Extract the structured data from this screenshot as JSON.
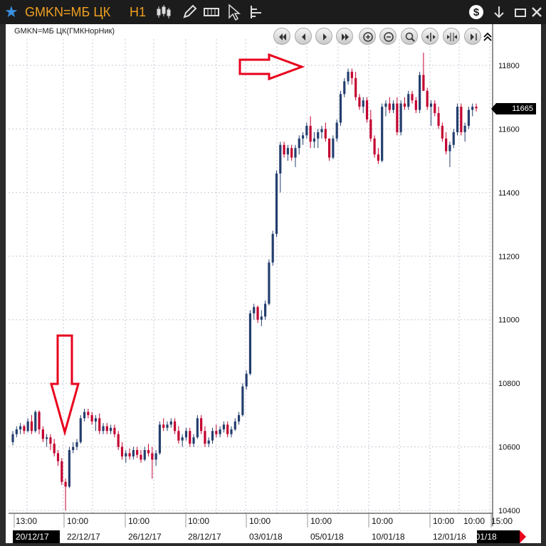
{
  "window": {
    "ticker": "GMKN=МБ ЦК",
    "timeframe": "H1",
    "instrument_label": "GMKN=МБ ЦК(ГМКНорНик)"
  },
  "toolbar": {
    "icons": [
      "star-icon",
      "candles-icon",
      "pencil-icon",
      "chart-type-icon",
      "cursor-icon",
      "levels-icon",
      "dollar-icon",
      "download-icon",
      "minimize-icon",
      "close-icon"
    ]
  },
  "nav": {
    "icons": [
      "scroll-begin-icon",
      "scroll-left-icon",
      "scroll-right-icon",
      "scroll-end-icon",
      "zoom-in-icon",
      "zoom-out-icon",
      "magnifier-icon",
      "compress-icon",
      "expand-icon",
      "scroll-last-icon"
    ]
  },
  "price_tag": "11665",
  "chart_data": {
    "type": "candlestick",
    "ylim": [
      10400,
      11850
    ],
    "yticks": [
      10400,
      10600,
      10800,
      11000,
      11200,
      11400,
      11600,
      11800
    ],
    "time_ticks": [
      "13:00",
      "10:00",
      "10:00",
      "10:00",
      "10:00",
      "10:00",
      "10:00",
      "10:00",
      "10:00",
      "15:00"
    ],
    "date_ticks": [
      "20/12/17",
      "22/12/17",
      "26/12/17",
      "28/12/17",
      "03/01/18",
      "05/01/18",
      "10/01/18",
      "12/01/18",
      "15/01/18"
    ],
    "colors": {
      "up": "#233e6e",
      "down": "#c3002f",
      "grid": "#c8c8d8",
      "arrow": "#e8001c"
    },
    "candles": [
      [
        10615,
        10650,
        10605,
        10640
      ],
      [
        10640,
        10665,
        10630,
        10655
      ],
      [
        10655,
        10675,
        10640,
        10665
      ],
      [
        10665,
        10670,
        10640,
        10650
      ],
      [
        10650,
        10690,
        10645,
        10680
      ],
      [
        10680,
        10700,
        10640,
        10650
      ],
      [
        10650,
        10715,
        10645,
        10710
      ],
      [
        10710,
        10715,
        10640,
        10655
      ],
      [
        10655,
        10665,
        10615,
        10625
      ],
      [
        10625,
        10640,
        10600,
        10630
      ],
      [
        10630,
        10640,
        10590,
        10610
      ],
      [
        10610,
        10625,
        10570,
        10580
      ],
      [
        10580,
        10590,
        10540,
        10555
      ],
      [
        10555,
        10565,
        10480,
        10490
      ],
      [
        10490,
        10500,
        10400,
        10475
      ],
      [
        10475,
        10600,
        10470,
        10590
      ],
      [
        10590,
        10615,
        10580,
        10600
      ],
      [
        10600,
        10625,
        10590,
        10615
      ],
      [
        10615,
        10700,
        10610,
        10690
      ],
      [
        10690,
        10720,
        10680,
        10710
      ],
      [
        10710,
        10720,
        10690,
        10700
      ],
      [
        10700,
        10710,
        10670,
        10680
      ],
      [
        10680,
        10700,
        10650,
        10690
      ],
      [
        10690,
        10705,
        10640,
        10650
      ],
      [
        10650,
        10675,
        10640,
        10665
      ],
      [
        10665,
        10675,
        10640,
        10650
      ],
      [
        10650,
        10670,
        10640,
        10660
      ],
      [
        10660,
        10670,
        10630,
        10640
      ],
      [
        10640,
        10650,
        10590,
        10600
      ],
      [
        10600,
        10615,
        10560,
        10570
      ],
      [
        10570,
        10590,
        10550,
        10580
      ],
      [
        10580,
        10595,
        10560,
        10570
      ],
      [
        10570,
        10600,
        10560,
        10590
      ],
      [
        10590,
        10600,
        10565,
        10575
      ],
      [
        10575,
        10590,
        10550,
        10560
      ],
      [
        10560,
        10600,
        10555,
        10590
      ],
      [
        10590,
        10610,
        10570,
        10580
      ],
      [
        10580,
        10600,
        10500,
        10560
      ],
      [
        10560,
        10590,
        10540,
        10580
      ],
      [
        10580,
        10680,
        10575,
        10670
      ],
      [
        10670,
        10690,
        10650,
        10660
      ],
      [
        10660,
        10680,
        10650,
        10670
      ],
      [
        10670,
        10690,
        10660,
        10680
      ],
      [
        10680,
        10690,
        10640,
        10650
      ],
      [
        10650,
        10665,
        10610,
        10620
      ],
      [
        10620,
        10640,
        10600,
        10630
      ],
      [
        10630,
        10660,
        10620,
        10650
      ],
      [
        10650,
        10660,
        10600,
        10610
      ],
      [
        10610,
        10640,
        10600,
        10630
      ],
      [
        10630,
        10700,
        10625,
        10690
      ],
      [
        10690,
        10700,
        10640,
        10650
      ],
      [
        10650,
        10665,
        10600,
        10610
      ],
      [
        10610,
        10630,
        10600,
        10620
      ],
      [
        10620,
        10660,
        10610,
        10650
      ],
      [
        10650,
        10670,
        10630,
        10640
      ],
      [
        10640,
        10665,
        10630,
        10655
      ],
      [
        10655,
        10680,
        10645,
        10670
      ],
      [
        10670,
        10680,
        10630,
        10640
      ],
      [
        10640,
        10665,
        10630,
        10655
      ],
      [
        10655,
        10690,
        10650,
        10680
      ],
      [
        10680,
        10710,
        10670,
        10700
      ],
      [
        10700,
        10800,
        10695,
        10790
      ],
      [
        10790,
        10840,
        10780,
        10830
      ],
      [
        10830,
        11030,
        10825,
        11020
      ],
      [
        11020,
        11050,
        11000,
        11040
      ],
      [
        11040,
        11045,
        10990,
        11000
      ],
      [
        11000,
        11030,
        10980,
        11010
      ],
      [
        11010,
        11060,
        11000,
        11050
      ],
      [
        11050,
        11190,
        11045,
        11180
      ],
      [
        11180,
        11280,
        11170,
        11270
      ],
      [
        11270,
        11470,
        11260,
        11460
      ],
      [
        11460,
        11560,
        11400,
        11550
      ],
      [
        11550,
        11560,
        11510,
        11520
      ],
      [
        11520,
        11550,
        11500,
        11540
      ],
      [
        11540,
        11550,
        11500,
        11510
      ],
      [
        11510,
        11550,
        11480,
        11540
      ],
      [
        11540,
        11580,
        11520,
        11570
      ],
      [
        11570,
        11590,
        11550,
        11580
      ],
      [
        11580,
        11620,
        11570,
        11610
      ],
      [
        11610,
        11640,
        11540,
        11560
      ],
      [
        11560,
        11590,
        11540,
        11570
      ],
      [
        11570,
        11600,
        11540,
        11590
      ],
      [
        11590,
        11610,
        11570,
        11600
      ],
      [
        11600,
        11620,
        11560,
        11570
      ],
      [
        11570,
        11570,
        11500,
        11510
      ],
      [
        11510,
        11580,
        11505,
        11570
      ],
      [
        11570,
        11630,
        11560,
        11620
      ],
      [
        11620,
        11720,
        11610,
        11710
      ],
      [
        11710,
        11760,
        11700,
        11750
      ],
      [
        11750,
        11790,
        11740,
        11780
      ],
      [
        11780,
        11790,
        11740,
        11760
      ],
      [
        11760,
        11780,
        11690,
        11700
      ],
      [
        11700,
        11710,
        11660,
        11670
      ],
      [
        11670,
        11700,
        11650,
        11690
      ],
      [
        11690,
        11700,
        11620,
        11630
      ],
      [
        11630,
        11660,
        11560,
        11570
      ],
      [
        11570,
        11580,
        11510,
        11520
      ],
      [
        11520,
        11540,
        11490,
        11500
      ],
      [
        11500,
        11680,
        11495,
        11670
      ],
      [
        11670,
        11690,
        11640,
        11680
      ],
      [
        11680,
        11700,
        11650,
        11660
      ],
      [
        11660,
        11690,
        11650,
        11680
      ],
      [
        11680,
        11700,
        11580,
        11590
      ],
      [
        11590,
        11690,
        11580,
        11680
      ],
      [
        11680,
        11700,
        11660,
        11670
      ],
      [
        11670,
        11720,
        11660,
        11710
      ],
      [
        11710,
        11720,
        11680,
        11690
      ],
      [
        11690,
        11700,
        11650,
        11660
      ],
      [
        11660,
        11780,
        11650,
        11770
      ],
      [
        11770,
        11840,
        11750,
        11720
      ],
      [
        11720,
        11730,
        11660,
        11670
      ],
      [
        11670,
        11690,
        11610,
        11680
      ],
      [
        11680,
        11690,
        11640,
        11650
      ],
      [
        11650,
        11670,
        11600,
        11610
      ],
      [
        11610,
        11620,
        11560,
        11570
      ],
      [
        11570,
        11590,
        11520,
        11530
      ],
      [
        11530,
        11560,
        11480,
        11550
      ],
      [
        11550,
        11600,
        11540,
        11590
      ],
      [
        11590,
        11680,
        11580,
        11670
      ],
      [
        11670,
        11680,
        11580,
        11590
      ],
      [
        11590,
        11620,
        11560,
        11610
      ],
      [
        11610,
        11670,
        11600,
        11660
      ],
      [
        11660,
        11680,
        11640,
        11670
      ],
      [
        11670,
        11680,
        11655,
        11665
      ]
    ]
  }
}
